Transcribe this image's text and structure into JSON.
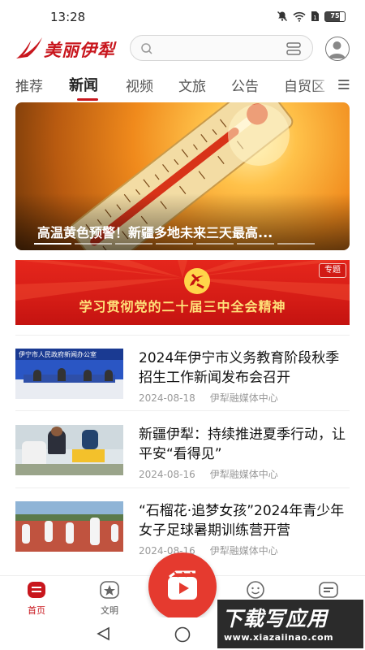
{
  "status_bar": {
    "time": "13:28",
    "battery": "75"
  },
  "header": {
    "logo_text": "美丽伊犁",
    "search_placeholder": ""
  },
  "tabs": [
    {
      "label": "推荐"
    },
    {
      "label": "新闻"
    },
    {
      "label": "视频"
    },
    {
      "label": "文旅"
    },
    {
      "label": "公告"
    },
    {
      "label": "自贸区"
    }
  ],
  "banner": {
    "title": "高温黄色预警！新疆多地未来三天最高..."
  },
  "special": {
    "tag": "专题",
    "text": "学习贯彻党的二十届三中全会精神"
  },
  "news": [
    {
      "title": "2024年伊宁市义务教育阶段秋季招生工作新闻发布会召开",
      "date": "2024-08-18",
      "source": "伊犁融媒体中心",
      "thumb_banner_text": "伊宁市人民政府新闻办公室"
    },
    {
      "title": "新疆伊犁：持续推进夏季行动，让平安“看得见”",
      "date": "2024-08-16",
      "source": "伊犁融媒体中心"
    },
    {
      "title": "“石榴花·追梦女孩”2024年青少年女子足球暑期训练营开营",
      "date": "2024-08-16",
      "source": "伊犁融媒体中心"
    }
  ],
  "bottom_nav": [
    {
      "label": "首页",
      "icon": "home-icon"
    },
    {
      "label": "文明",
      "icon": "civilization-icon"
    },
    {
      "label": "",
      "icon": "video-icon"
    },
    {
      "label": "",
      "icon": "smile-icon"
    },
    {
      "label": "",
      "icon": "message-icon"
    }
  ],
  "watermark": {
    "main": "下载写应用",
    "url": "www.xiazaiinao.com"
  },
  "colors": {
    "brand_red": "#c8161d",
    "fab_red": "#e53a2f"
  }
}
